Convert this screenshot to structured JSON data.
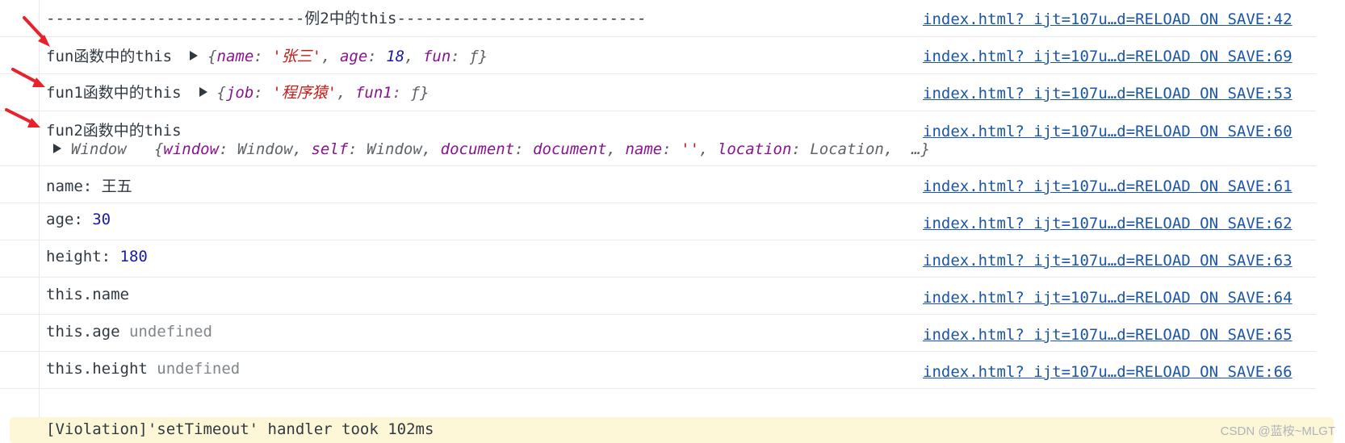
{
  "rows": [
    {
      "message": "----------------------------例2中的this---------------------------",
      "source": "index.html? ijt=107u…d=RELOAD ON SAVE:42"
    },
    {
      "label": "fun函数中的this",
      "obj": {
        "open": "{",
        "k1": "name",
        "v1": "'张三'",
        "k2": "age",
        "v2": "18",
        "k3": "fun",
        "v3": "ƒ",
        "close": "}"
      },
      "source": "index.html? ijt=107u…d=RELOAD ON SAVE:69"
    },
    {
      "label": "fun1函数中的this",
      "obj": {
        "open": "{",
        "k1": "job",
        "v1": "'程序猿'",
        "k2": "fun1",
        "v2": "ƒ",
        "close": "}"
      },
      "source": "index.html? ijt=107u…d=RELOAD ON SAVE:53"
    },
    {
      "label": "fun2函数中的this",
      "window_label": "Window",
      "obj": {
        "open": "{",
        "k1": "window",
        "v1": "Window",
        "k2": "self",
        "v2": "Window",
        "k3": "document",
        "v3": "document",
        "k4": "name",
        "v4": "''",
        "k5": "location",
        "v5": "Location",
        "ellipsis": "…}"
      },
      "source": "index.html? ijt=107u…d=RELOAD ON SAVE:60"
    },
    {
      "prefix": "name:",
      "value": "王五",
      "source": "index.html? ijt=107u…d=RELOAD ON SAVE:61"
    },
    {
      "prefix": "age:",
      "value": "30",
      "source": "index.html? ijt=107u…d=RELOAD ON SAVE:62"
    },
    {
      "prefix": "height:",
      "value": "180",
      "source": "index.html? ijt=107u…d=RELOAD ON SAVE:63"
    },
    {
      "prefix": "this.name",
      "source": "index.html? ijt=107u…d=RELOAD ON SAVE:64"
    },
    {
      "prefix": "this.age",
      "value": "undefined",
      "source": "index.html? ijt=107u…d=RELOAD ON SAVE:65"
    },
    {
      "prefix": "this.height",
      "value": "undefined",
      "source": "index.html? ijt=107u…d=RELOAD ON SAVE:66"
    }
  ],
  "violation": "[Violation]'setTimeout' handler took 102ms",
  "watermark": "CSDN @蓝桉~MLGT",
  "colors": {
    "arrow": "#e8212a",
    "link": "#1a55a8",
    "violation_bg": "#fdf6d7"
  }
}
